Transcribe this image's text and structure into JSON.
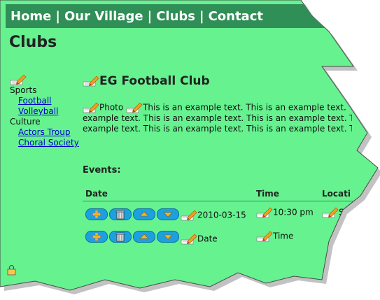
{
  "nav": {
    "items": [
      "Home",
      "Our Village",
      "Clubs",
      "Contact"
    ],
    "separator": "|"
  },
  "page_title": "Clubs",
  "sidebar": {
    "categories": [
      {
        "label": "Sports",
        "items": [
          "Football",
          "Volleyball"
        ]
      },
      {
        "label": "Culture",
        "items": [
          "Actors Troup",
          "Choral Society"
        ]
      }
    ]
  },
  "club": {
    "title": "EG Football Club",
    "photo_label": "Photo",
    "lines": [
      "This is an example text. This is an example text.",
      "example text. This is an example text. This is an example text. Th",
      "example text. This is an example text. This is an example text. Th"
    ]
  },
  "events": {
    "heading": "Events:",
    "columns": [
      "Date",
      "Time",
      "Locati"
    ],
    "rows": [
      {
        "date": "2010-03-15",
        "time": "10:30 pm",
        "location": "S"
      },
      {
        "date": "Date",
        "time": "Time",
        "location": ""
      }
    ]
  },
  "icons": {
    "edit": "edit-pencil-icon",
    "add": "plus-icon",
    "delete": "trash-icon",
    "up": "arrow-up-icon",
    "down": "arrow-down-icon",
    "lock": "lock-icon"
  },
  "colors": {
    "background": "#66f28f",
    "nav_bg": "#2f8f57",
    "button": "#1ea0df"
  }
}
